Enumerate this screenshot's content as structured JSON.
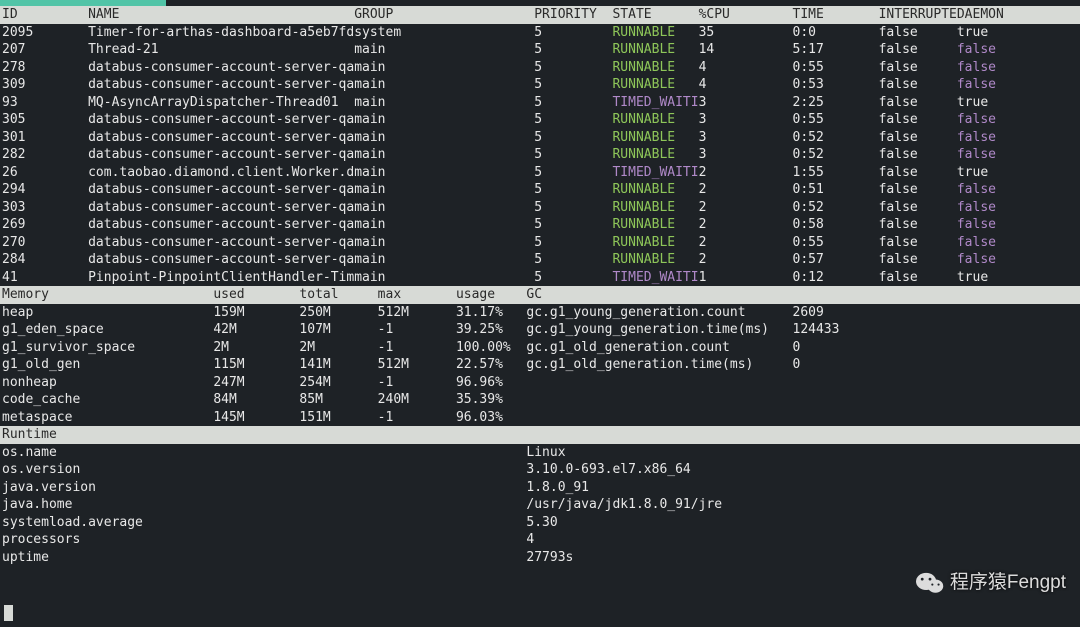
{
  "threads": {
    "headers": {
      "id": "ID",
      "name": "NAME",
      "group": "GROUP",
      "priority": "PRIORITY",
      "state": "STATE",
      "cpu": "%CPU",
      "time": "TIME",
      "interrupte": "INTERRUPTE",
      "daemon": "DAEMON"
    },
    "rows": [
      {
        "id": "2095",
        "name": "Timer-for-arthas-dashboard-a5eb7fd",
        "group": "system",
        "priority": "5",
        "state": "RUNNABLE",
        "cpu": "35",
        "time": "0:0",
        "interrupte": "false",
        "daemon": "true"
      },
      {
        "id": "207",
        "name": "Thread-21",
        "group": "main",
        "priority": "5",
        "state": "RUNNABLE",
        "cpu": "14",
        "time": "5:17",
        "interrupte": "false",
        "daemon": "false"
      },
      {
        "id": "278",
        "name": "databus-consumer-account-server-qa",
        "group": "main",
        "priority": "5",
        "state": "RUNNABLE",
        "cpu": "4",
        "time": "0:55",
        "interrupte": "false",
        "daemon": "false"
      },
      {
        "id": "309",
        "name": "databus-consumer-account-server-qa",
        "group": "main",
        "priority": "5",
        "state": "RUNNABLE",
        "cpu": "4",
        "time": "0:53",
        "interrupte": "false",
        "daemon": "false"
      },
      {
        "id": "93",
        "name": "MQ-AsyncArrayDispatcher-Thread01",
        "group": "main",
        "priority": "5",
        "state": "TIMED_WAITI",
        "cpu": "3",
        "time": "2:25",
        "interrupte": "false",
        "daemon": "true"
      },
      {
        "id": "305",
        "name": "databus-consumer-account-server-qa",
        "group": "main",
        "priority": "5",
        "state": "RUNNABLE",
        "cpu": "3",
        "time": "0:55",
        "interrupte": "false",
        "daemon": "false"
      },
      {
        "id": "301",
        "name": "databus-consumer-account-server-qa",
        "group": "main",
        "priority": "5",
        "state": "RUNNABLE",
        "cpu": "3",
        "time": "0:52",
        "interrupte": "false",
        "daemon": "false"
      },
      {
        "id": "282",
        "name": "databus-consumer-account-server-qa",
        "group": "main",
        "priority": "5",
        "state": "RUNNABLE",
        "cpu": "3",
        "time": "0:52",
        "interrupte": "false",
        "daemon": "false"
      },
      {
        "id": "26",
        "name": "com.taobao.diamond.client.Worker.d",
        "group": "main",
        "priority": "5",
        "state": "TIMED_WAITI",
        "cpu": "2",
        "time": "1:55",
        "interrupte": "false",
        "daemon": "true"
      },
      {
        "id": "294",
        "name": "databus-consumer-account-server-qa",
        "group": "main",
        "priority": "5",
        "state": "RUNNABLE",
        "cpu": "2",
        "time": "0:51",
        "interrupte": "false",
        "daemon": "false"
      },
      {
        "id": "303",
        "name": "databus-consumer-account-server-qa",
        "group": "main",
        "priority": "5",
        "state": "RUNNABLE",
        "cpu": "2",
        "time": "0:52",
        "interrupte": "false",
        "daemon": "false"
      },
      {
        "id": "269",
        "name": "databus-consumer-account-server-qa",
        "group": "main",
        "priority": "5",
        "state": "RUNNABLE",
        "cpu": "2",
        "time": "0:58",
        "interrupte": "false",
        "daemon": "false"
      },
      {
        "id": "270",
        "name": "databus-consumer-account-server-qa",
        "group": "main",
        "priority": "5",
        "state": "RUNNABLE",
        "cpu": "2",
        "time": "0:55",
        "interrupte": "false",
        "daemon": "false"
      },
      {
        "id": "284",
        "name": "databus-consumer-account-server-qa",
        "group": "main",
        "priority": "5",
        "state": "RUNNABLE",
        "cpu": "2",
        "time": "0:57",
        "interrupte": "false",
        "daemon": "false"
      },
      {
        "id": "41",
        "name": "Pinpoint-PinpointClientHandler-Tim",
        "group": "main",
        "priority": "5",
        "state": "TIMED_WAITI",
        "cpu": "1",
        "time": "0:12",
        "interrupte": "false",
        "daemon": "true"
      }
    ]
  },
  "memory": {
    "title": "Memory",
    "headers": {
      "used": "used",
      "total": "total",
      "max": "max",
      "usage": "usage",
      "gc": "GC"
    },
    "rows": [
      {
        "name": "heap",
        "used": "159M",
        "total": "250M",
        "max": "512M",
        "usage": "31.17%"
      },
      {
        "name": "g1_eden_space",
        "used": "42M",
        "total": "107M",
        "max": "-1",
        "usage": "39.25%"
      },
      {
        "name": "g1_survivor_space",
        "used": "2M",
        "total": "2M",
        "max": "-1",
        "usage": "100.00%"
      },
      {
        "name": "g1_old_gen",
        "used": "115M",
        "total": "141M",
        "max": "512M",
        "usage": "22.57%"
      },
      {
        "name": "nonheap",
        "used": "247M",
        "total": "254M",
        "max": "-1",
        "usage": "96.96%"
      },
      {
        "name": "code_cache",
        "used": "84M",
        "total": "85M",
        "max": "240M",
        "usage": "35.39%"
      },
      {
        "name": "metaspace",
        "used": "145M",
        "total": "151M",
        "max": "-1",
        "usage": "96.03%"
      }
    ],
    "gc": [
      {
        "k": "gc.g1_young_generation.count",
        "v": "2609"
      },
      {
        "k": "gc.g1_young_generation.time(ms)",
        "v": "124433"
      },
      {
        "k": "gc.g1_old_generation.count",
        "v": "0"
      },
      {
        "k": "gc.g1_old_generation.time(ms)",
        "v": "0"
      }
    ]
  },
  "runtime": {
    "title": "Runtime",
    "rows": [
      {
        "k": "os.name",
        "v": "Linux"
      },
      {
        "k": "os.version",
        "v": "3.10.0-693.el7.x86_64"
      },
      {
        "k": "java.version",
        "v": "1.8.0_91"
      },
      {
        "k": "java.home",
        "v": "/usr/java/jdk1.8.0_91/jre"
      },
      {
        "k": "systemload.average",
        "v": "5.30"
      },
      {
        "k": "processors",
        "v": "4"
      },
      {
        "k": "uptime",
        "v": "27793s"
      }
    ]
  },
  "watermark": "程序猿Fengpt"
}
